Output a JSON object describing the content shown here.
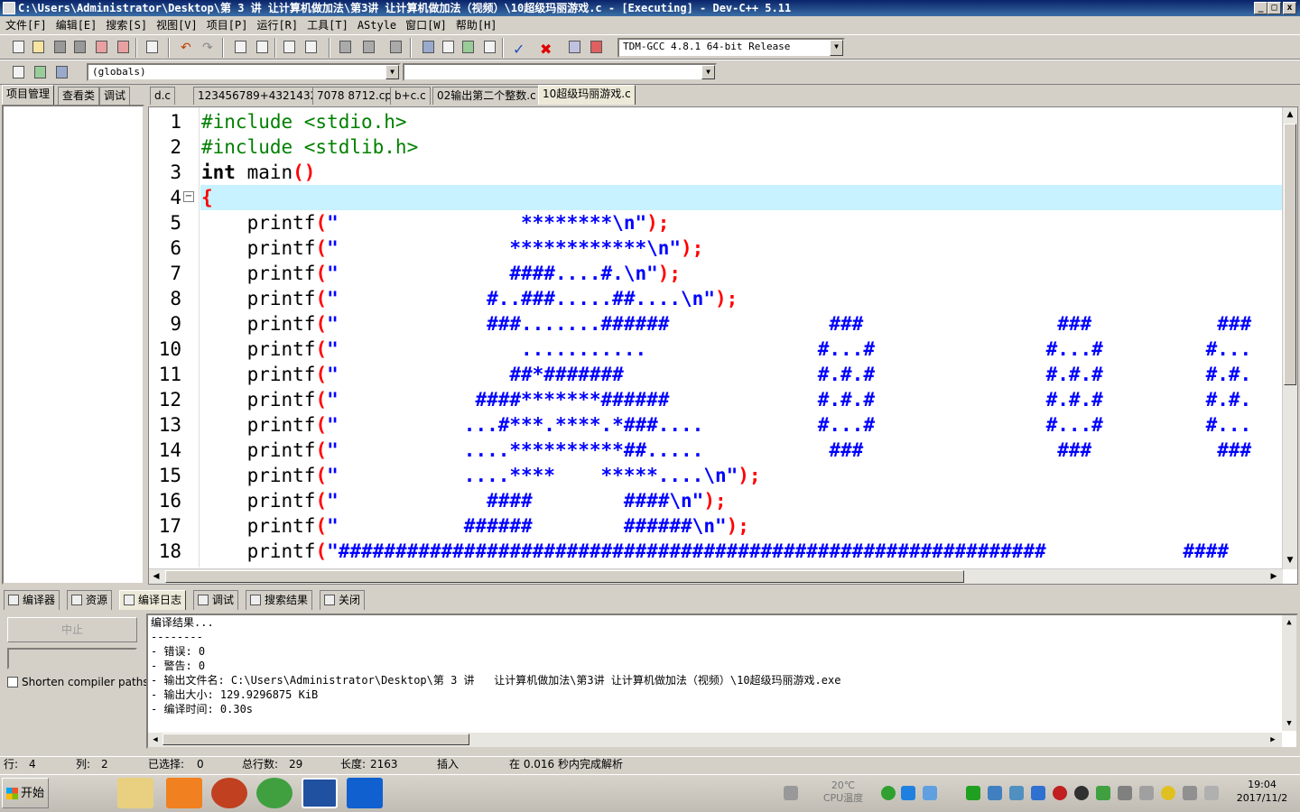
{
  "window": {
    "title": "C:\\Users\\Administrator\\Desktop\\第 3 讲   让计算机做加法\\第3讲 让计算机做加法（视频）\\10超级玛丽游戏.c - [Executing] - Dev-C++ 5.11",
    "min": "_",
    "max": "□",
    "close": "x"
  },
  "menu": [
    "文件[F]",
    "编辑[E]",
    "搜索[S]",
    "视图[V]",
    "项目[P]",
    "运行[R]",
    "工具[T]",
    "AStyle",
    "窗口[W]",
    "帮助[H]"
  ],
  "toolbar": {
    "compiler": "TDM-GCC 4.8.1 64-bit Release",
    "scope": "(globals)",
    "function": ""
  },
  "left_tabs": [
    "项目管理",
    "查看类",
    "调试"
  ],
  "file_tabs": [
    "d.c",
    "123456789+43214321.c",
    "7078 8712.cpp",
    "b+c.c",
    "02输出第二个整数.c",
    "10超级玛丽游戏.c"
  ],
  "editor": {
    "line_numbers": [
      "1",
      "2",
      "3",
      "4",
      "5",
      "6",
      "7",
      "8",
      "9",
      "10",
      "11",
      "12",
      "13",
      "14",
      "15",
      "16",
      "17",
      "18"
    ],
    "lines": [
      [
        {
          "c": "cl-inc",
          "t": "#include <stdio.h>"
        }
      ],
      [
        {
          "c": "cl-inc",
          "t": "#include <stdlib.h>"
        }
      ],
      [
        {
          "c": "cl-kw",
          "t": "int"
        },
        {
          "c": "",
          "t": " main"
        },
        {
          "c": "cl-red",
          "t": "()"
        }
      ],
      [
        {
          "c": "cl-red",
          "t": "{"
        }
      ],
      [
        {
          "c": "",
          "t": "    printf"
        },
        {
          "c": "cl-red",
          "t": "("
        },
        {
          "c": "cl-str",
          "t": "\"                ********\\n\""
        },
        {
          "c": "cl-red",
          "t": ");"
        }
      ],
      [
        {
          "c": "",
          "t": "    printf"
        },
        {
          "c": "cl-red",
          "t": "("
        },
        {
          "c": "cl-str",
          "t": "\"               ************\\n\""
        },
        {
          "c": "cl-red",
          "t": ");"
        }
      ],
      [
        {
          "c": "",
          "t": "    printf"
        },
        {
          "c": "cl-red",
          "t": "("
        },
        {
          "c": "cl-str",
          "t": "\"               ####....#.\\n\""
        },
        {
          "c": "cl-red",
          "t": ");"
        }
      ],
      [
        {
          "c": "",
          "t": "    printf"
        },
        {
          "c": "cl-red",
          "t": "("
        },
        {
          "c": "cl-str",
          "t": "\"             #..###.....##....\\n\""
        },
        {
          "c": "cl-red",
          "t": ");"
        }
      ],
      [
        {
          "c": "",
          "t": "    printf"
        },
        {
          "c": "cl-red",
          "t": "("
        },
        {
          "c": "cl-str",
          "t": "\"             ###.......######              ###                 ###           ###"
        }
      ],
      [
        {
          "c": "",
          "t": "    printf"
        },
        {
          "c": "cl-red",
          "t": "("
        },
        {
          "c": "cl-str",
          "t": "\"                ...........               #...#               #...#         #..."
        }
      ],
      [
        {
          "c": "",
          "t": "    printf"
        },
        {
          "c": "cl-red",
          "t": "("
        },
        {
          "c": "cl-str",
          "t": "\"               ##*#######                 #.#.#               #.#.#         #.#."
        }
      ],
      [
        {
          "c": "",
          "t": "    printf"
        },
        {
          "c": "cl-red",
          "t": "("
        },
        {
          "c": "cl-str",
          "t": "\"            ####*******######             #.#.#               #.#.#         #.#."
        }
      ],
      [
        {
          "c": "",
          "t": "    printf"
        },
        {
          "c": "cl-red",
          "t": "("
        },
        {
          "c": "cl-str",
          "t": "\"           ...#***.****.*###....          #...#               #...#         #..."
        }
      ],
      [
        {
          "c": "",
          "t": "    printf"
        },
        {
          "c": "cl-red",
          "t": "("
        },
        {
          "c": "cl-str",
          "t": "\"           ....**********##.....           ###                 ###           ###"
        }
      ],
      [
        {
          "c": "",
          "t": "    printf"
        },
        {
          "c": "cl-red",
          "t": "("
        },
        {
          "c": "cl-str",
          "t": "\"           ....****    *****....\\n\""
        },
        {
          "c": "cl-red",
          "t": ");"
        }
      ],
      [
        {
          "c": "",
          "t": "    printf"
        },
        {
          "c": "cl-red",
          "t": "("
        },
        {
          "c": "cl-str",
          "t": "\"             ####        ####\\n\""
        },
        {
          "c": "cl-red",
          "t": ");"
        }
      ],
      [
        {
          "c": "",
          "t": "    printf"
        },
        {
          "c": "cl-red",
          "t": "("
        },
        {
          "c": "cl-str",
          "t": "\"           ######        ######\\n\""
        },
        {
          "c": "cl-red",
          "t": ");"
        }
      ],
      [
        {
          "c": "",
          "t": "    printf"
        },
        {
          "c": "cl-red",
          "t": "("
        },
        {
          "c": "cl-str",
          "t": "\"##############################################################            ####"
        }
      ]
    ]
  },
  "bottom_tabs": [
    "编译器",
    "资源",
    "编译日志",
    "调试",
    "搜索结果",
    "关闭"
  ],
  "bottom_left": {
    "abort": "中止",
    "shorten": "Shorten compiler paths"
  },
  "log": [
    "编译结果...",
    "--------",
    "- 错误: 0",
    "- 警告: 0",
    "- 输出文件名: C:\\Users\\Administrator\\Desktop\\第 3 讲   让计算机做加法\\第3讲 让计算机做加法（视频）\\10超级玛丽游戏.exe",
    "- 输出大小: 129.9296875 KiB",
    "- 编译时间: 0.30s"
  ],
  "status": {
    "row_label": "行:",
    "row": "4",
    "col_label": "列:",
    "col": "2",
    "sel_label": "已选择:",
    "sel": "0",
    "total_label": "总行数:",
    "total": "29",
    "len_label": "长度:",
    "len": "2163",
    "mode": "插入",
    "parse": "在 0.016 秒内完成解析"
  },
  "taskbar": {
    "start": "开始",
    "cpu_temp": "20℃",
    "cpu_label": "CPU温度",
    "time": "19:04",
    "date": "2017/11/2"
  }
}
